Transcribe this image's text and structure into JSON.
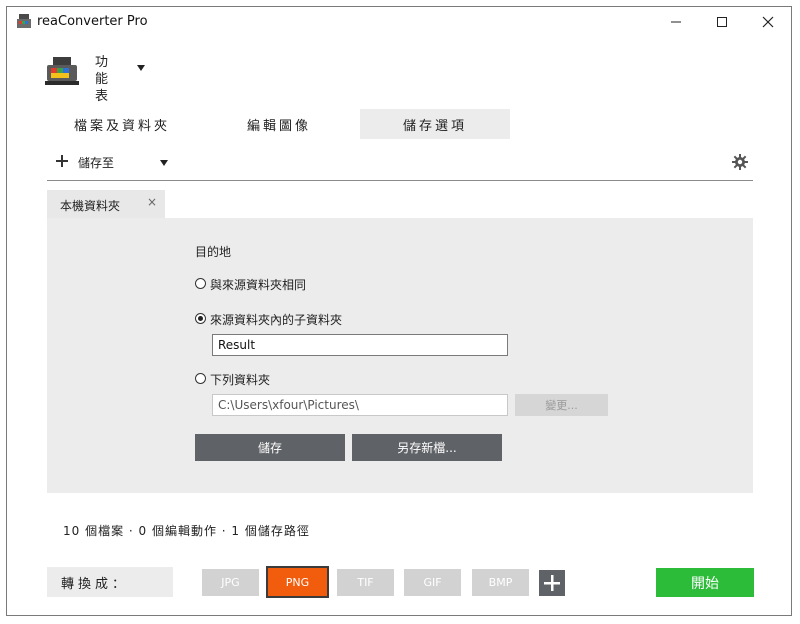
{
  "window": {
    "title": "reaConverter Pro"
  },
  "menu": {
    "label": "功能表"
  },
  "tabs": [
    {
      "label": "檔案及資料夾",
      "active": false
    },
    {
      "label": "編輯圖像",
      "active": false
    },
    {
      "label": "儲存選項",
      "active": true
    }
  ],
  "toolbar": {
    "save_to_label": "儲存至"
  },
  "subtab": {
    "label": "本機資料夾",
    "close": "×"
  },
  "destination": {
    "heading": "目的地",
    "options": [
      {
        "label": "與來源資料夾相同",
        "selected": false
      },
      {
        "label": "來源資料夾內的子資料夾",
        "selected": true
      },
      {
        "label": "下列資料夾",
        "selected": false
      }
    ],
    "subfolder_value": "Result",
    "folder_path": "C:\\Users\\xfour\\Pictures\\",
    "change_button": "變更..."
  },
  "actions": {
    "save": "儲存",
    "save_as": "另存新檔..."
  },
  "status": "10 個檔案 · 0 個編輯動作 · 1 個儲存路徑",
  "convert": {
    "label": "轉換成：",
    "formats": [
      "JPG",
      "PNG",
      "TIF",
      "GIF",
      "BMP"
    ],
    "selected": "PNG"
  },
  "start_button": "開始",
  "colors": {
    "accent_orange": "#f25c0d",
    "start_green": "#2dbb3a",
    "dark_button": "#5f6266",
    "panel_bg": "#ececec"
  }
}
